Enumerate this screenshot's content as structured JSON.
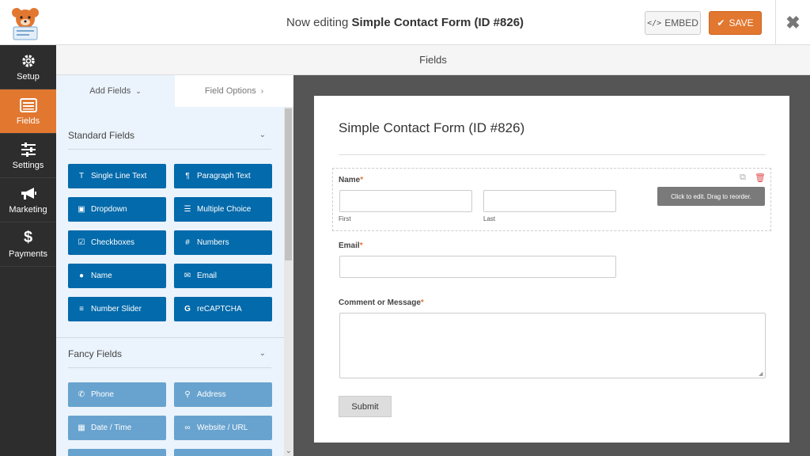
{
  "header": {
    "title_prefix": "Now editing",
    "form_name": "Simple Contact Form (ID #826)",
    "embed_label": "EMBED",
    "save_label": "SAVE"
  },
  "nav": {
    "items": [
      {
        "label": "Setup",
        "icon": "gear-icon"
      },
      {
        "label": "Fields",
        "icon": "list-icon",
        "active": true
      },
      {
        "label": "Settings",
        "icon": "sliders-icon"
      },
      {
        "label": "Marketing",
        "icon": "megaphone-icon"
      },
      {
        "label": "Payments",
        "icon": "dollar-icon"
      }
    ]
  },
  "fields_header": "Fields",
  "panel": {
    "tabs": [
      {
        "label": "Add Fields",
        "active": true
      },
      {
        "label": "Field Options",
        "active": false
      }
    ],
    "standard_title": "Standard Fields",
    "standard": [
      {
        "label": "Single Line Text",
        "icon": "text-icon"
      },
      {
        "label": "Paragraph Text",
        "icon": "paragraph-icon"
      },
      {
        "label": "Dropdown",
        "icon": "dropdown-icon"
      },
      {
        "label": "Multiple Choice",
        "icon": "list-icon"
      },
      {
        "label": "Checkboxes",
        "icon": "checkbox-icon"
      },
      {
        "label": "Numbers",
        "icon": "hash-icon"
      },
      {
        "label": "Name",
        "icon": "user-icon"
      },
      {
        "label": "Email",
        "icon": "envelope-icon"
      },
      {
        "label": "Number Slider",
        "icon": "sliders-icon"
      },
      {
        "label": "reCAPTCHA",
        "icon": "google-icon"
      }
    ],
    "fancy_title": "Fancy Fields",
    "fancy": [
      {
        "label": "Phone",
        "icon": "phone-icon"
      },
      {
        "label": "Address",
        "icon": "map-marker-icon"
      },
      {
        "label": "Date / Time",
        "icon": "calendar-icon"
      },
      {
        "label": "Website / URL",
        "icon": "link-icon"
      }
    ]
  },
  "form": {
    "title": "Simple Contact Form (ID #826)",
    "name_label": "Name",
    "first_sub": "First",
    "last_sub": "Last",
    "email_label": "Email",
    "message_label": "Comment or Message",
    "required_mark": "*",
    "tooltip": "Click to edit. Drag to reorder.",
    "submit_label": "Submit"
  },
  "colors": {
    "accent": "#e27730",
    "standard_button": "#036aab",
    "fancy_button": "#68a3cf",
    "nav_bg": "#2d2d2d"
  }
}
